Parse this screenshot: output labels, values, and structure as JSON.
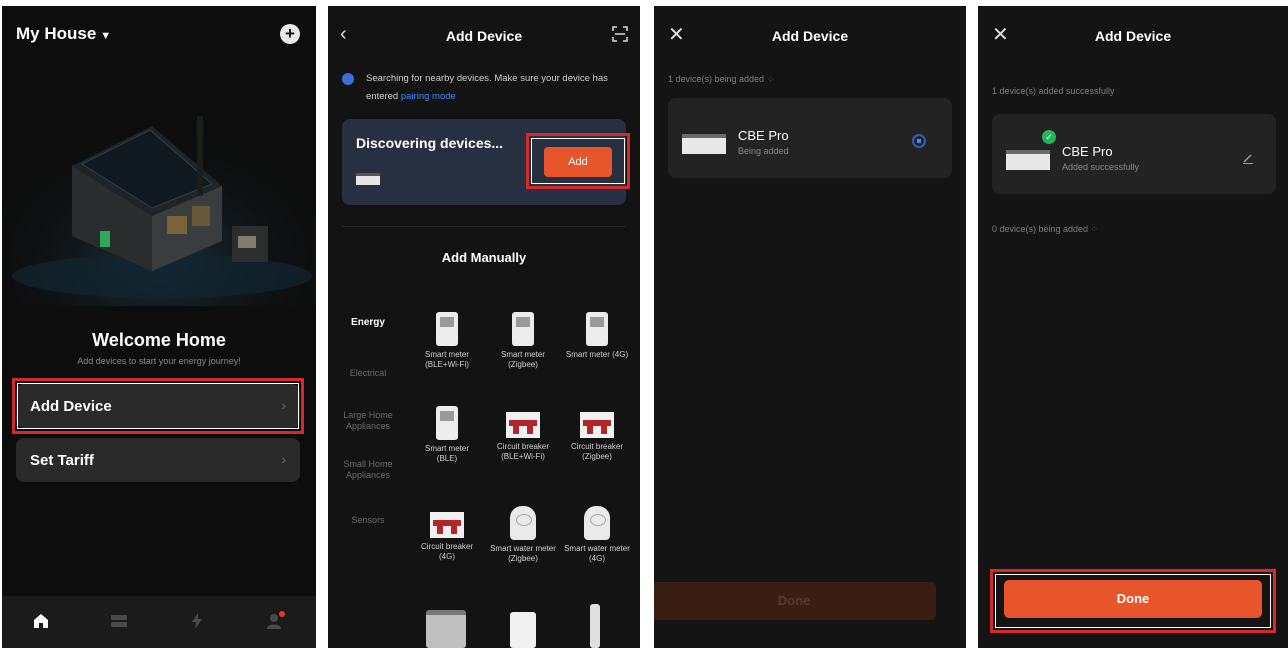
{
  "screen1": {
    "home_name": "My House",
    "welcome_title": "Welcome Home",
    "welcome_sub": "Add devices to start your energy journey!",
    "rows": [
      {
        "label": "Add Device"
      },
      {
        "label": "Set Tariff"
      }
    ],
    "tabs": [
      "home-icon",
      "devices-icon",
      "energy-icon",
      "profile-icon"
    ]
  },
  "screen2": {
    "title": "Add Device",
    "search_msg": "Searching for nearby devices. Make sure your device has entered",
    "search_link": "pairing mode",
    "discovering": "Discovering devices...",
    "add_button": "Add",
    "add_manually": "Add Manually",
    "categories": [
      "Energy",
      "Electrical",
      "Large Home Appliances",
      "Small Home Appliances",
      "Sensors"
    ],
    "devices": [
      {
        "label": "Smart meter (BLE+Wi-Fi)",
        "kind": "meter"
      },
      {
        "label": "Smart meter (Zigbee)",
        "kind": "meter"
      },
      {
        "label": "Smart meter (4G)",
        "kind": "meter"
      },
      {
        "label": "Smart meter (BLE)",
        "kind": "meter"
      },
      {
        "label": "Circuit breaker (BLE+Wi-Fi)",
        "kind": "breaker"
      },
      {
        "label": "Circuit breaker (Zigbee)",
        "kind": "breaker"
      },
      {
        "label": "Circuit breaker (4G)",
        "kind": "breaker"
      },
      {
        "label": "Smart water meter (Zigbee)",
        "kind": "water"
      },
      {
        "label": "Smart water meter (4G)",
        "kind": "water"
      }
    ]
  },
  "screen3": {
    "title": "Add Device",
    "status": "1 device(s) being added",
    "device_name": "CBE Pro",
    "device_status": "Being added",
    "done": "Done"
  },
  "screen4": {
    "title": "Add Device",
    "status_success": "1 device(s) added successfully",
    "device_name": "CBE Pro",
    "device_status": "Added successfully",
    "status_pending": "0 device(s) being added",
    "done": "Done"
  },
  "colors": {
    "accent": "#E8552A",
    "highlight": "#D42A2A",
    "link": "#3C8CFF",
    "success": "#27B35A"
  }
}
